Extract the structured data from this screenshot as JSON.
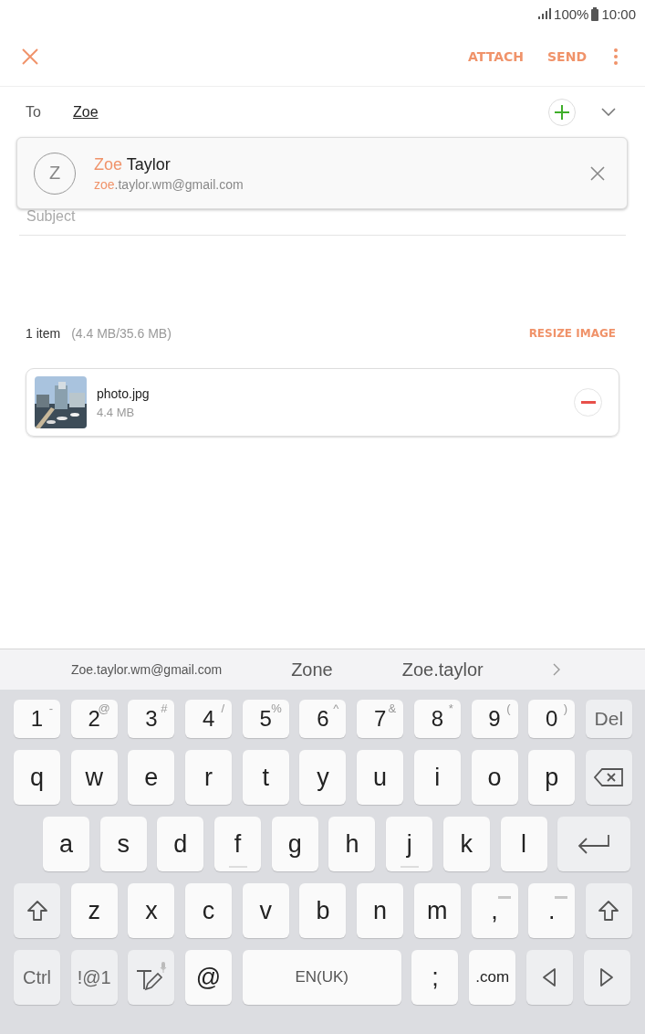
{
  "status_bar": {
    "battery": "100%",
    "time": "10:00"
  },
  "toolbar": {
    "actions": [
      "ATTACH",
      "SEND"
    ]
  },
  "to_field": {
    "label": "To",
    "value": "Zoe"
  },
  "suggestion": {
    "initial": "Z",
    "name": [
      {
        "text": "Zoe",
        "highlight": true
      },
      {
        "text": " Taylor",
        "highlight": false
      }
    ],
    "email": [
      {
        "text": "zoe",
        "highlight": true
      },
      {
        "text": ".taylor.wm@gmail.com",
        "highlight": false
      }
    ]
  },
  "subject": {
    "placeholder": "Subject"
  },
  "attachments": {
    "count": "1 item",
    "size": "(4.4 MB/35.6 MB)",
    "action": "RESIZE IMAGE",
    "items": [
      {
        "kind": "picture",
        "name": "photo.jpg",
        "size": "4.4 MB"
      }
    ]
  },
  "keyboard": {
    "suggestions": [
      {
        "text": "Zoe.taylor.wm@gmail.com",
        "kind": "address"
      },
      {
        "text": "Zone",
        "kind": "word"
      },
      {
        "text": "Zoe.taylor",
        "kind": "word"
      }
    ],
    "rows": [
      {
        "keys": [
          {
            "kind": "char",
            "label": "1",
            "hint": "-"
          },
          {
            "kind": "char",
            "label": "2",
            "hint": "@"
          },
          {
            "kind": "char",
            "label": "3",
            "hint": "#"
          },
          {
            "kind": "char",
            "label": "4",
            "hint": "/"
          },
          {
            "kind": "char",
            "label": "5",
            "hint": "%"
          },
          {
            "kind": "char",
            "label": "6",
            "hint": "^"
          },
          {
            "kind": "char",
            "label": "7",
            "hint": "&"
          },
          {
            "kind": "char",
            "label": "8",
            "hint": "*"
          },
          {
            "kind": "char",
            "label": "9",
            "hint": "("
          },
          {
            "kind": "char",
            "label": "0",
            "hint": ")"
          },
          {
            "kind": "func",
            "label": "Del"
          }
        ]
      },
      {
        "keys": [
          {
            "kind": "char",
            "label": "q"
          },
          {
            "kind": "char",
            "label": "w"
          },
          {
            "kind": "char",
            "label": "e"
          },
          {
            "kind": "char",
            "label": "r"
          },
          {
            "kind": "char",
            "label": "t"
          },
          {
            "kind": "char",
            "label": "y"
          },
          {
            "kind": "char",
            "label": "u"
          },
          {
            "kind": "char",
            "label": "i"
          },
          {
            "kind": "char",
            "label": "o"
          },
          {
            "kind": "char",
            "label": "p"
          },
          {
            "kind": "backspace"
          }
        ]
      },
      {
        "keys": [
          {
            "kind": "char",
            "label": "a"
          },
          {
            "kind": "char",
            "label": "s"
          },
          {
            "kind": "char",
            "label": "d"
          },
          {
            "kind": "char",
            "label": "f",
            "bump": true
          },
          {
            "kind": "char",
            "label": "g"
          },
          {
            "kind": "char",
            "label": "h"
          },
          {
            "kind": "char",
            "label": "j",
            "bump": true
          },
          {
            "kind": "char",
            "label": "k"
          },
          {
            "kind": "char",
            "label": "l"
          },
          {
            "kind": "enter"
          }
        ]
      },
      {
        "keys": [
          {
            "kind": "shift"
          },
          {
            "kind": "char",
            "label": "z"
          },
          {
            "kind": "char",
            "label": "x"
          },
          {
            "kind": "char",
            "label": "c"
          },
          {
            "kind": "char",
            "label": "v"
          },
          {
            "kind": "char",
            "label": "b"
          },
          {
            "kind": "char",
            "label": "n"
          },
          {
            "kind": "char",
            "label": "m"
          },
          {
            "kind": "char",
            "label": ",",
            "bar": true
          },
          {
            "kind": "char",
            "label": ".",
            "bar": true
          },
          {
            "kind": "shift"
          }
        ]
      },
      {
        "keys": [
          {
            "kind": "func",
            "label": "Ctrl"
          },
          {
            "kind": "func",
            "label": "!@1"
          },
          {
            "kind": "handwriting"
          },
          {
            "kind": "char",
            "label": "@"
          },
          {
            "kind": "space",
            "label": "EN(UK)"
          },
          {
            "kind": "char",
            "label": ";"
          },
          {
            "kind": "char",
            "label": ".com",
            "small": true
          },
          {
            "kind": "left"
          },
          {
            "kind": "right"
          }
        ]
      }
    ]
  }
}
